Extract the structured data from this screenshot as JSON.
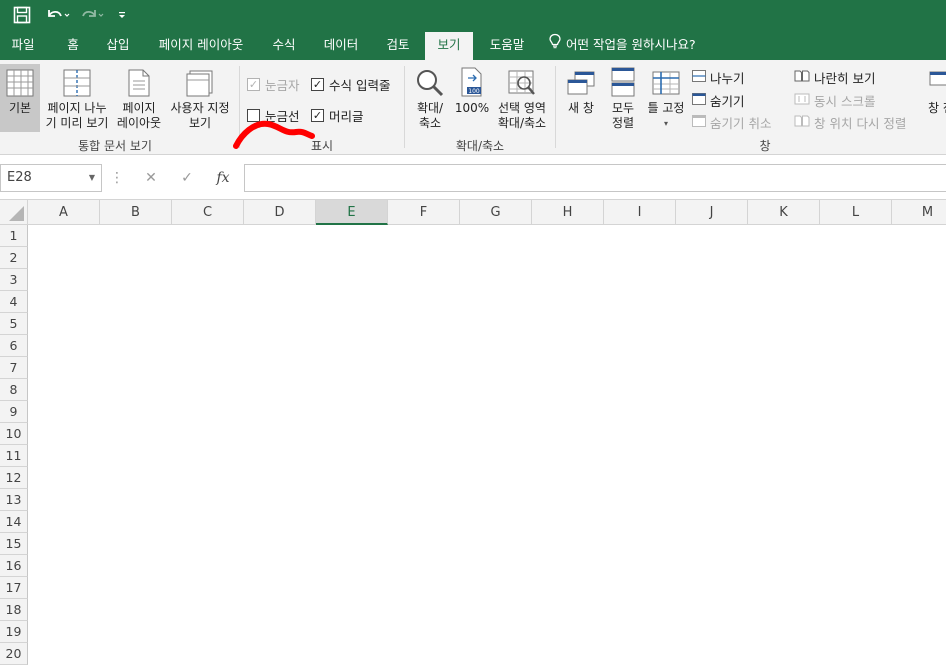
{
  "qat": {
    "save_icon": "save-icon",
    "undo_icon": "undo-icon",
    "redo_icon": "redo-icon",
    "customize_icon": "customize-qat-icon"
  },
  "tabs": [
    {
      "label": "파일"
    },
    {
      "label": "홈"
    },
    {
      "label": "삽입"
    },
    {
      "label": "페이지 레이아웃"
    },
    {
      "label": "수식"
    },
    {
      "label": "데이터"
    },
    {
      "label": "검토"
    },
    {
      "label": "보기",
      "active": true
    },
    {
      "label": "도움말"
    }
  ],
  "tell_me": "어떤 작업을 원하시나요?",
  "ribbon": {
    "workbook_views": {
      "label": "통합 문서 보기",
      "normal": "기본",
      "page_break_1": "페이지 나누",
      "page_break_2": "기 미리 보기",
      "page_layout_1": "페이지",
      "page_layout_2": "레이아웃",
      "custom_1": "사용자 지정",
      "custom_2": "보기"
    },
    "show": {
      "label": "표시",
      "ruler": "눈금자",
      "formula_bar": "수식 입력줄",
      "gridlines": "눈금선",
      "headings": "머리글"
    },
    "zoom": {
      "label": "확대/축소",
      "zoom_1": "확대/",
      "zoom_2": "축소",
      "hundred": "100%",
      "selection_1": "선택 영역",
      "selection_2": "확대/축소"
    },
    "window": {
      "label": "창",
      "new_window_1": "새 창",
      "arrange_1": "모두",
      "arrange_2": "정렬",
      "freeze": "틀 고정",
      "split": "나누기",
      "hide": "숨기기",
      "unhide": "숨기기 취소",
      "side_by_side": "나란히 보기",
      "sync_scroll": "동시 스크롤",
      "reset_position": "창 위치 다시 정렬",
      "switch_1": "창 전"
    }
  },
  "formula_bar": {
    "name_box": "E28",
    "cancel_icon": "✕",
    "enter_icon": "✓",
    "fx_icon": "fx",
    "formula": ""
  },
  "columns": [
    "A",
    "B",
    "C",
    "D",
    "E",
    "F",
    "G",
    "H",
    "I",
    "J",
    "K",
    "L",
    "M"
  ],
  "selected_column": "E",
  "rows": [
    "1",
    "2",
    "3",
    "4",
    "5",
    "6",
    "7",
    "8",
    "9",
    "10",
    "11",
    "12",
    "13",
    "14",
    "15",
    "16",
    "17",
    "18",
    "19",
    "20"
  ],
  "colors": {
    "accent": "#217346",
    "annotation": "#ff0000"
  }
}
